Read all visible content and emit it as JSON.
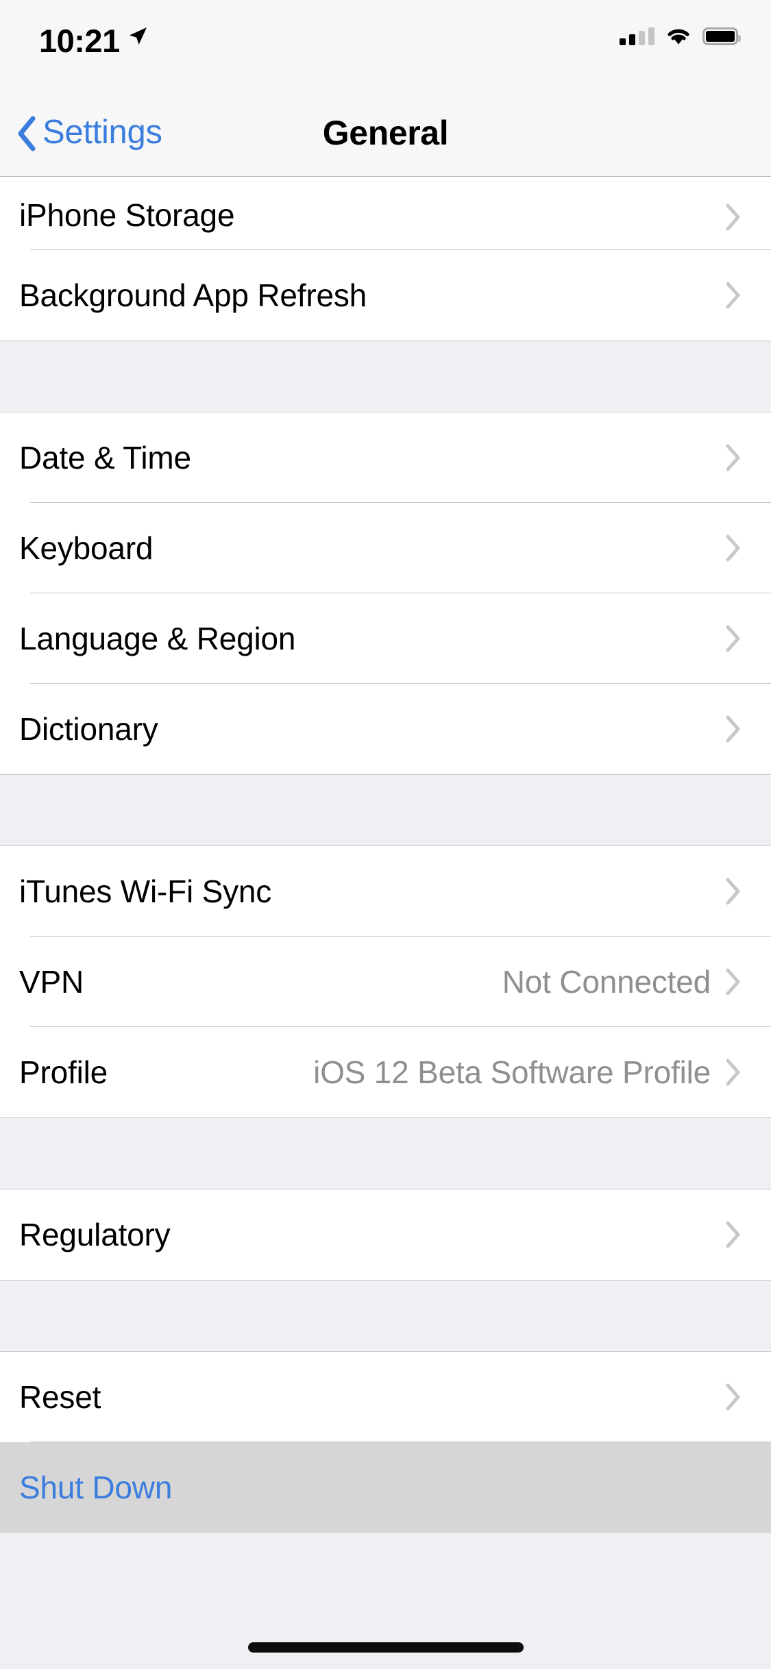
{
  "status_bar": {
    "time": "10:21",
    "location_icon": "location-arrow-icon",
    "cellular_icon": "cellular-signal-icon",
    "cellular_bars_filled": 2,
    "cellular_bars_total": 4,
    "wifi_icon": "wifi-icon",
    "battery_icon": "battery-full-icon"
  },
  "nav_bar": {
    "back_label": "Settings",
    "back_icon": "chevron-left-icon",
    "title": "General"
  },
  "colors": {
    "accent_blue": "#3b7ddd",
    "value_gray": "#8e8e93",
    "chevron_gray": "#c7c7cc",
    "group_background": "#efeff4",
    "row_background": "#ffffff",
    "pressed_background": "#d6d6d6",
    "separator": "#c8c7cc",
    "nav_background": "#f7f7f7"
  },
  "sections": [
    {
      "rows": [
        {
          "label": "iPhone Storage",
          "value": "",
          "chevron": true,
          "clipped": true
        },
        {
          "label": "Background App Refresh",
          "value": "",
          "chevron": true,
          "clipped": false
        }
      ]
    },
    {
      "rows": [
        {
          "label": "Date & Time",
          "value": "",
          "chevron": true,
          "clipped": false
        },
        {
          "label": "Keyboard",
          "value": "",
          "chevron": true,
          "clipped": false
        },
        {
          "label": "Language & Region",
          "value": "",
          "chevron": true,
          "clipped": false
        },
        {
          "label": "Dictionary",
          "value": "",
          "chevron": true,
          "clipped": false
        }
      ]
    },
    {
      "rows": [
        {
          "label": "iTunes Wi-Fi Sync",
          "value": "",
          "chevron": true,
          "clipped": false
        },
        {
          "label": "VPN",
          "value": "Not Connected",
          "chevron": true,
          "clipped": false
        },
        {
          "label": "Profile",
          "value": "iOS 12 Beta Software Profile",
          "chevron": true,
          "clipped": false
        }
      ]
    },
    {
      "rows": [
        {
          "label": "Regulatory",
          "value": "",
          "chevron": true,
          "clipped": false
        }
      ]
    },
    {
      "rows": [
        {
          "label": "Reset",
          "value": "",
          "chevron": true,
          "clipped": false
        },
        {
          "label": "Shut Down",
          "value": "",
          "chevron": false,
          "clipped": false,
          "accent": true,
          "pressed": true
        }
      ]
    }
  ],
  "home_indicator": "home-indicator-bar"
}
